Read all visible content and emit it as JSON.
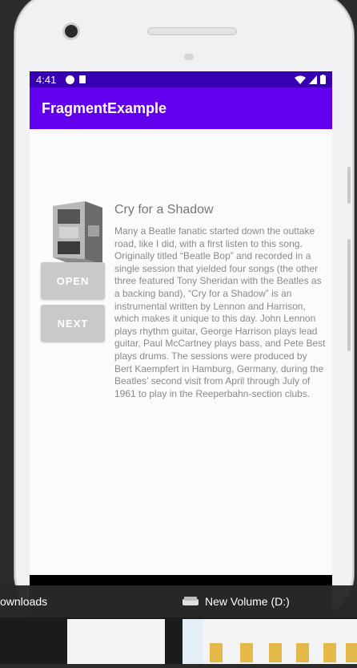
{
  "status": {
    "time": "4:41"
  },
  "app": {
    "title": "FragmentExample"
  },
  "buttons": {
    "open": "OPEN",
    "next": "NEXT"
  },
  "song": {
    "title": "Cry for a Shadow",
    "description": "Many a Beatle fanatic started down the outtake road, like I did, with a first listen to this song. Originally titled “Beatle Bop” and recorded in a single session that yielded four songs (the other three featured Tony Sheridan with the Beatles as a backing band), “Cry for a Shadow” is an instrumental written by Lennon and Harrison, which makes it unique to this day. John Lennon plays rhythm guitar, George Harrison plays lead guitar, Paul McCartney plays bass, and Pete Best plays drums. The sessions were produced by Bert Kaempfert in Hamburg, Germany, during the Beatles’ second visit from April through July of 1961 to play in the Reeperbahn-section clubs."
  },
  "taskbar": {
    "left_label": "ownloads",
    "right_label": "New Volume (D:)"
  }
}
